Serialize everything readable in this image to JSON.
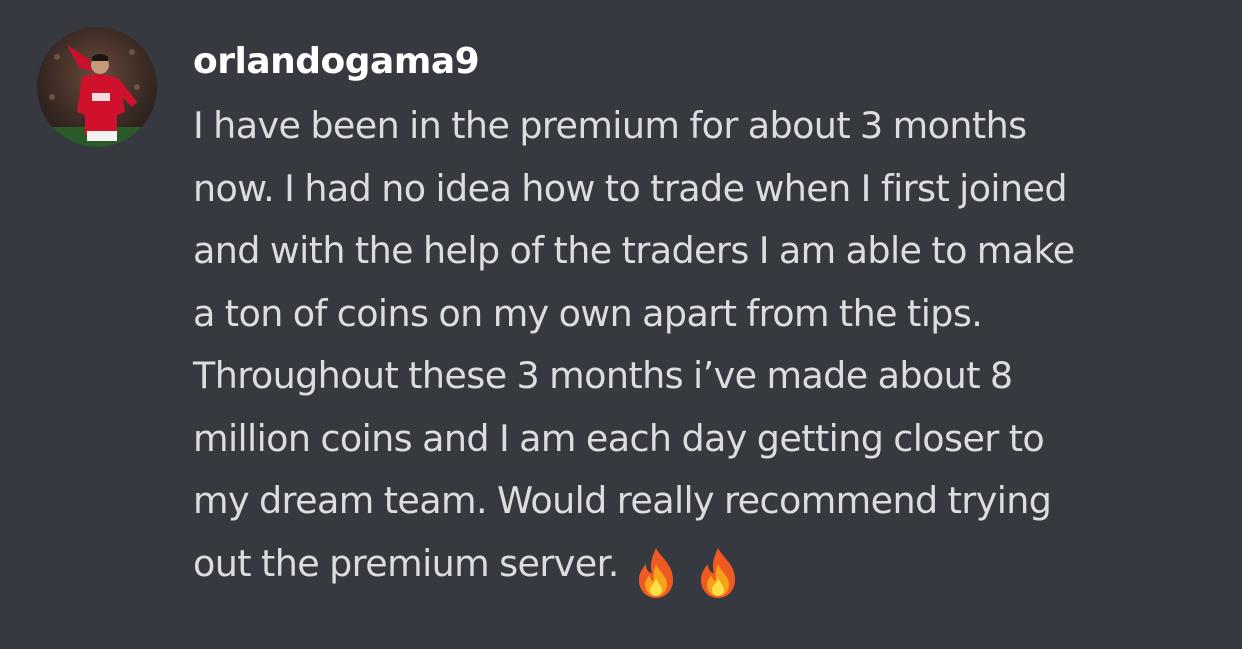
{
  "message": {
    "author": "orlandogama9",
    "avatar_icon": "user-avatar-photo",
    "lines": [
      "I have been in the premium for about 3 months",
      "now. I had no idea how to trade when I first joined",
      "and with the help of the traders I am able to make",
      "a ton of coins on my own apart from the tips.",
      "Throughout these 3 months i’ve made about 8",
      "million coins and I am each day getting closer to",
      "my dream team. Would really recommend trying",
      "out the premium server."
    ],
    "reactions_inline": [
      "fire-icon",
      "fire-icon"
    ]
  },
  "colors": {
    "background": "#36393f",
    "username": "#ffffff",
    "text": "#dcddde"
  }
}
